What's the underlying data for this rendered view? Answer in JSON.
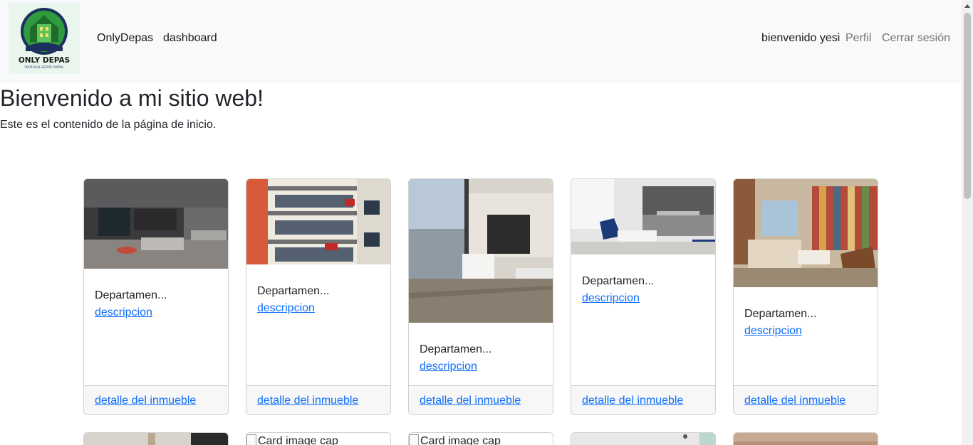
{
  "navbar": {
    "brand": "OnlyDepas",
    "dashboard": "dashboard",
    "welcome": "bienvenido yesi",
    "profile": "Perfil",
    "logout": "Cerrar sesión",
    "logo_text": "ONLY DEPAS",
    "logo_tagline": "YOUR REAL ESTATE PORTAL"
  },
  "main": {
    "title": "Bienvenido a mi sitio web!",
    "intro": "Este es el contenido de la página de inicio."
  },
  "cards": [
    {
      "title": "Departamen...",
      "link": "descripcion",
      "footer": "detalle del inmueble"
    },
    {
      "title": "Departamen...",
      "link": "descripcion",
      "footer": "detalle del inmueble"
    },
    {
      "title": "Departamen...",
      "link": "descripcion",
      "footer": "detalle del inmueble"
    },
    {
      "title": "Departamen...",
      "link": "descripcion",
      "footer": "detalle del inmueble"
    },
    {
      "title": "Departamen...",
      "link": "descripcion",
      "footer": "detalle del inmueble"
    }
  ],
  "second_row": [
    {
      "alt": ""
    },
    {
      "alt": "Card image cap"
    },
    {
      "alt": "Card image cap"
    },
    {
      "alt": ""
    },
    {
      "alt": ""
    }
  ],
  "colors": {
    "link": "#0d6efd",
    "navbar_bg": "#f8f9fa",
    "logo_green": "#2e8b3a"
  }
}
